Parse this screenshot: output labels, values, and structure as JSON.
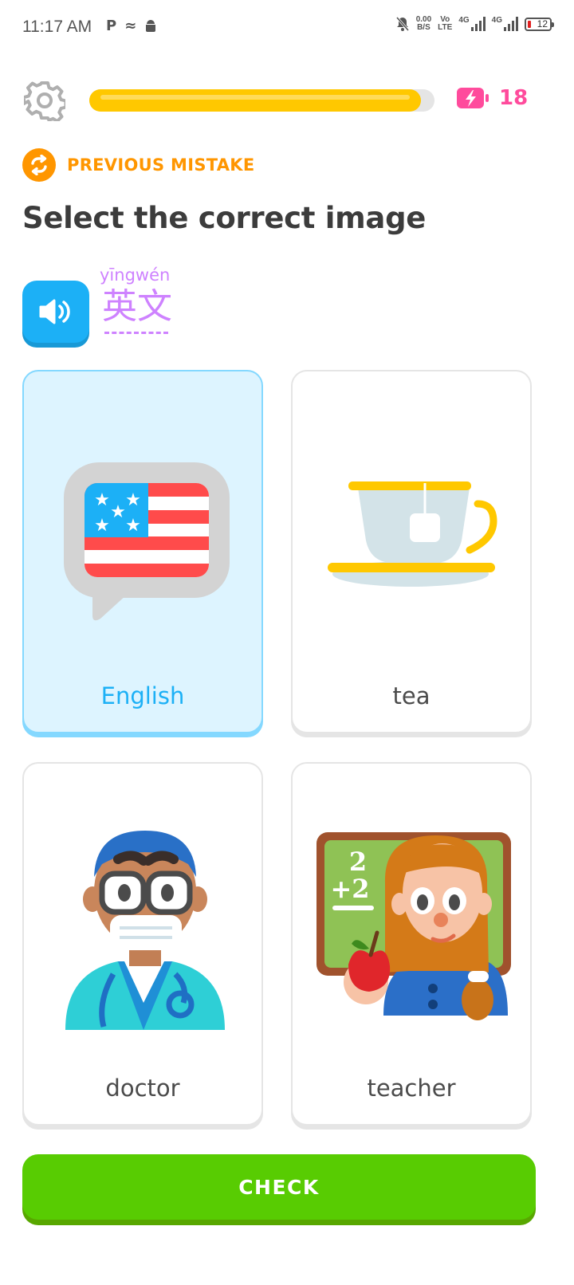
{
  "status_bar": {
    "time": "11:17 AM",
    "left_icons": [
      "P",
      "≈",
      "android-icon"
    ],
    "net_speed": "0.00",
    "net_unit": "B/S",
    "volte_top": "Vo",
    "volte_bottom": "LTE",
    "sim1": "4G",
    "sim2": "4G",
    "battery": "12"
  },
  "header": {
    "progress_percent": 96,
    "energy_count": "18"
  },
  "previous_mistake": {
    "label": "PREVIOUS MISTAKE"
  },
  "title": "Select the correct image",
  "prompt": {
    "pinyin": "yīngwén",
    "hanzi": "英文"
  },
  "choices": [
    {
      "label": "English",
      "icon": "us-flag-speech-bubble",
      "selected": true
    },
    {
      "label": "tea",
      "icon": "teacup",
      "selected": false
    },
    {
      "label": "doctor",
      "icon": "doctor",
      "selected": false
    },
    {
      "label": "teacher",
      "icon": "teacher",
      "selected": false
    }
  ],
  "check_label": "CHECK",
  "colors": {
    "accent_green": "#58cc02",
    "accent_blue": "#1cb0f6",
    "progress_yellow": "#ffc800",
    "energy_pink": "#ff4b9c",
    "mistake_orange": "#ff9600",
    "hanzi_purple": "#ce82ff"
  }
}
